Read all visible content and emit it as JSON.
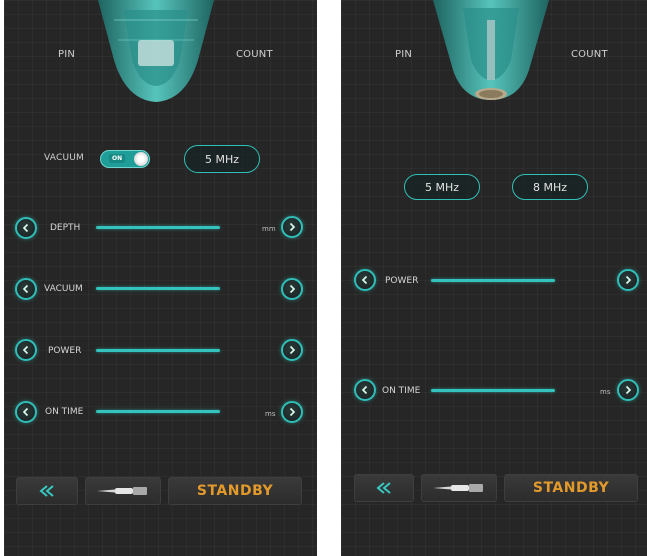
{
  "left_screen": {
    "pin_label": "PIN",
    "count_label": "COUNT",
    "vacuum_toggle": {
      "label": "VACUUM",
      "state_text": "ON"
    },
    "frequency": "5 MHz",
    "params": [
      {
        "label": "DEPTH",
        "unit": "mm"
      },
      {
        "label": "VACUUM",
        "unit": ""
      },
      {
        "label": "POWER",
        "unit": ""
      },
      {
        "label": "ON TIME",
        "unit": "ms"
      }
    ],
    "standby_label": "STANDBY"
  },
  "right_screen": {
    "pin_label": "PIN",
    "count_label": "COUNT",
    "frequencies": [
      "5 MHz",
      "8 MHz"
    ],
    "params": [
      {
        "label": "POWER",
        "unit": ""
      },
      {
        "label": "ON TIME",
        "unit": "ms"
      }
    ],
    "standby_label": "STANDBY"
  },
  "colors": {
    "accent": "#2fbfb8",
    "standby": "#e39a2a",
    "background": "#262626"
  },
  "icons": [
    "chevron-left-icon",
    "chevron-right-icon",
    "rewind-icon",
    "handpiece-tip-icon"
  ]
}
